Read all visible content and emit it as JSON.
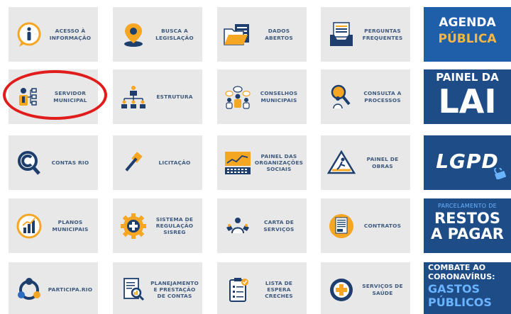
{
  "tiles": [
    {
      "id": "acesso",
      "lines": [
        "ACESSO À",
        "INFORMAÇÃO"
      ],
      "icon": "info-bubble-icon"
    },
    {
      "id": "busca",
      "lines": [
        "BUSCA A",
        "LEGISLAÇÃO"
      ],
      "icon": "map-pin-icon"
    },
    {
      "id": "dados",
      "lines": [
        "DADOS",
        "ABERTOS"
      ],
      "icon": "open-folder-icon"
    },
    {
      "id": "perguntas",
      "lines": [
        "PERGUNTAS",
        "FREQUENTES"
      ],
      "icon": "inbox-tray-icon"
    },
    {
      "id": "servidor",
      "lines": [
        "SERVIDOR",
        "MUNICIPAL"
      ],
      "icon": "employee-org-icon"
    },
    {
      "id": "estrutura",
      "lines": [
        "ESTRUTURA"
      ],
      "icon": "org-chart-icon"
    },
    {
      "id": "conselhos",
      "lines": [
        "CONSELHOS",
        "MUNICIPAIS"
      ],
      "icon": "council-chat-icon"
    },
    {
      "id": "consulta",
      "lines": [
        "CONSULTA A",
        "PROCESSOS"
      ],
      "icon": "magnifier-person-icon"
    },
    {
      "id": "contas",
      "lines": [
        "CONTAS RIO"
      ],
      "icon": "c-magnifier-icon"
    },
    {
      "id": "licitacao",
      "lines": [
        "LICITAÇÃO"
      ],
      "icon": "gavel-icon"
    },
    {
      "id": "painel-os",
      "lines": [
        "PAINEL DAS",
        "ORGANIZAÇÕES",
        "SOCIAIS"
      ],
      "icon": "dashboard-chart-icon"
    },
    {
      "id": "painel-obras",
      "lines": [
        "PAINEL DE",
        "OBRAS"
      ],
      "icon": "construction-sign-icon"
    },
    {
      "id": "planos",
      "lines": [
        "PLANOS",
        "MUNICIPAIS"
      ],
      "icon": "bar-chart-circle-icon"
    },
    {
      "id": "sisreg",
      "lines": [
        "SISTEMA DE",
        "REGULAÇÃO",
        "SISREG"
      ],
      "icon": "health-gear-icon"
    },
    {
      "id": "carta",
      "lines": [
        "CARTA DE",
        "SERVIÇOS"
      ],
      "icon": "service-person-icon"
    },
    {
      "id": "contratos",
      "lines": [
        "CONTRATOS"
      ],
      "icon": "document-circle-icon"
    },
    {
      "id": "participa",
      "lines": [
        "PARTICIPA.RIO"
      ],
      "icon": "participation-icon"
    },
    {
      "id": "planejamento",
      "lines": [
        "PLANEJAMENTO",
        "E PRESTAÇÃO",
        "DE CONTAS"
      ],
      "icon": "report-magnifier-icon"
    },
    {
      "id": "lista",
      "lines": [
        "LISTA DE",
        "ESPERA",
        "CRECHES"
      ],
      "icon": "checklist-icon"
    },
    {
      "id": "saude",
      "lines": [
        "SERVIÇOS DE",
        "SAÚDE"
      ],
      "icon": "health-cross-icon"
    }
  ],
  "banners": {
    "agenda": {
      "line1": "AGENDA",
      "line2": "PÚBLICA"
    },
    "painel_lai": {
      "line1": "PAINEL DA",
      "line2": "LAI"
    },
    "lgpd": {
      "text": "LGPD"
    },
    "restos": {
      "line1": "PARCELAMENTO DE",
      "line2": "RESTOS",
      "line3": "A PAGAR"
    },
    "covid": {
      "line1": "COMBATE AO",
      "line2": "CORONAVÍRUS:",
      "line3": "GASTOS",
      "line4": "PÚBLICOS"
    }
  },
  "colors": {
    "tile_bg": "#e8e8e8",
    "label": "#3d5a7e",
    "navy": "#1e3f6e",
    "orange": "#f5a623",
    "blue": "#2d6cc0",
    "highlight_ring": "#e01c1c"
  }
}
